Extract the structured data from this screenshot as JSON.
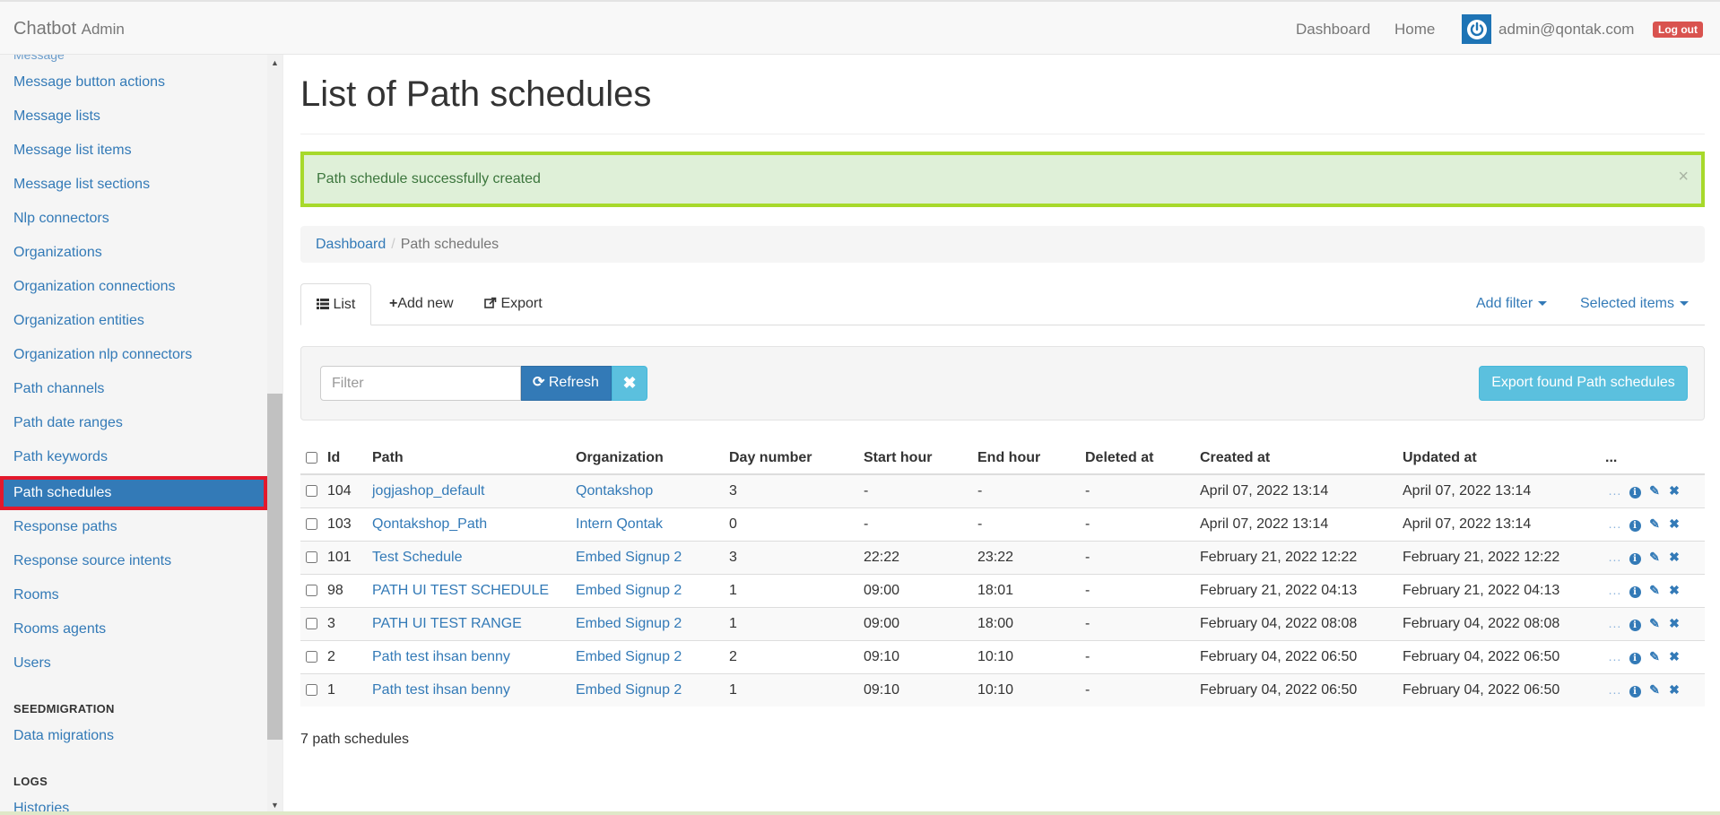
{
  "navbar": {
    "brand": "Chatbot",
    "brand_sub": "Admin",
    "dashboard": "Dashboard",
    "home": "Home",
    "user": "admin@qontak.com",
    "logout": "Log out"
  },
  "sidebar": {
    "items": [
      "Message button actions",
      "Message lists",
      "Message list items",
      "Message list sections",
      "Nlp connectors",
      "Organizations",
      "Organization connections",
      "Organization entities",
      "Organization nlp connectors",
      "Path channels",
      "Path date ranges",
      "Path keywords",
      "Path schedules",
      "Response paths",
      "Response source intents",
      "Rooms",
      "Rooms agents",
      "Users"
    ],
    "active_item": "Path schedules",
    "section_seedmigration": "SEEDMIGRATION",
    "data_migrations": "Data migrations",
    "section_logs": "LOGS",
    "histories": "Histories"
  },
  "page": {
    "title": "List of Path schedules",
    "alert": "Path schedule successfully created",
    "alert_close": "×",
    "breadcrumb": [
      "Dashboard",
      "Path schedules"
    ],
    "tabs": {
      "list": "List",
      "add_new": "Add new",
      "export": "Export"
    },
    "add_filter": "Add filter",
    "selected_items": "Selected items",
    "filter_placeholder": "Filter",
    "refresh": "Refresh",
    "export_found": "Export found Path schedules",
    "count_text": "7 path schedules"
  },
  "table": {
    "headers": {
      "id": "Id",
      "path": "Path",
      "organization": "Organization",
      "day_number": "Day number",
      "start_hour": "Start hour",
      "end_hour": "End hour",
      "deleted_at": "Deleted at",
      "created_at": "Created at",
      "updated_at": "Updated at",
      "more": "..."
    },
    "rows": [
      {
        "id": "104",
        "path": "jogjashop_default",
        "organization": "Qontakshop",
        "day_number": "3",
        "start_hour": "-",
        "end_hour": "-",
        "deleted_at": "-",
        "created_at": "April 07, 2022 13:14",
        "updated_at": "April 07, 2022 13:14"
      },
      {
        "id": "103",
        "path": "Qontakshop_Path",
        "organization": "Intern Qontak",
        "day_number": "0",
        "start_hour": "-",
        "end_hour": "-",
        "deleted_at": "-",
        "created_at": "April 07, 2022 13:14",
        "updated_at": "April 07, 2022 13:14"
      },
      {
        "id": "101",
        "path": "Test Schedule",
        "organization": "Embed Signup 2",
        "day_number": "3",
        "start_hour": "22:22",
        "end_hour": "23:22",
        "deleted_at": "-",
        "created_at": "February 21, 2022 12:22",
        "updated_at": "February 21, 2022 12:22"
      },
      {
        "id": "98",
        "path": "PATH UI TEST SCHEDULE",
        "organization": "Embed Signup 2",
        "day_number": "1",
        "start_hour": "09:00",
        "end_hour": "18:01",
        "deleted_at": "-",
        "created_at": "February 21, 2022 04:13",
        "updated_at": "February 21, 2022 04:13"
      },
      {
        "id": "3",
        "path": "PATH UI TEST RANGE",
        "organization": "Embed Signup 2",
        "day_number": "1",
        "start_hour": "09:00",
        "end_hour": "18:00",
        "deleted_at": "-",
        "created_at": "February 04, 2022 08:08",
        "updated_at": "February 04, 2022 08:08"
      },
      {
        "id": "2",
        "path": "Path test ihsan benny",
        "organization": "Embed Signup 2",
        "day_number": "2",
        "start_hour": "09:10",
        "end_hour": "10:10",
        "deleted_at": "-",
        "created_at": "February 04, 2022 06:50",
        "updated_at": "February 04, 2022 06:50"
      },
      {
        "id": "1",
        "path": "Path test ihsan benny",
        "organization": "Embed Signup 2",
        "day_number": "1",
        "start_hour": "09:10",
        "end_hour": "10:10",
        "deleted_at": "-",
        "created_at": "February 04, 2022 06:50",
        "updated_at": "February 04, 2022 06:50"
      }
    ]
  },
  "icons": {
    "list": "list-icon",
    "add": "plus-icon",
    "export": "share-icon",
    "refresh": "refresh-icon",
    "clear": "close-icon",
    "row_actions": [
      "ellipsis-icon",
      "info-icon",
      "pencil-icon",
      "delete-icon"
    ]
  },
  "colors": {
    "primary": "#337ab7",
    "info": "#5bc0de",
    "danger": "#d9534f",
    "success_bg": "#dff0d8",
    "success_text": "#3c763d",
    "alert_border": "#a7d92b",
    "active_outline": "#e3192c"
  }
}
